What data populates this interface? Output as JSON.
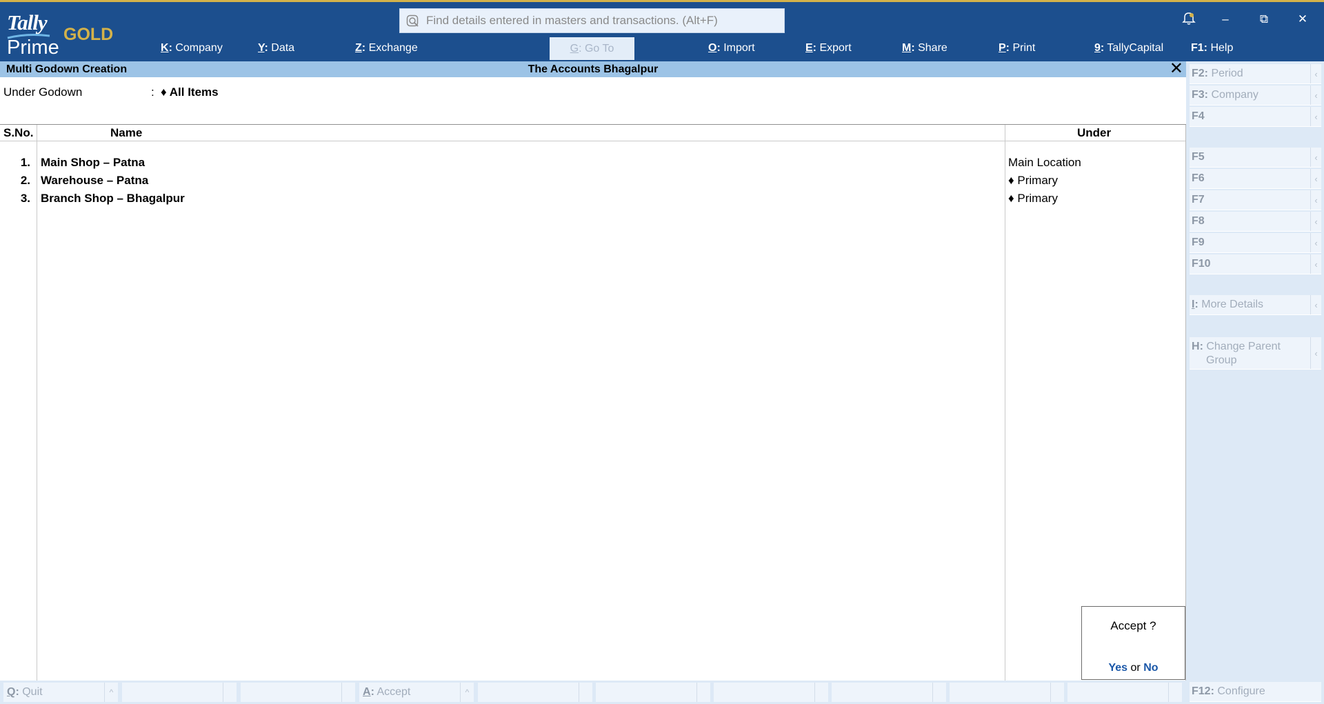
{
  "app": {
    "logo_tally": "Tally",
    "logo_prime": "Prime",
    "logo_edition": "GOLD"
  },
  "search": {
    "placeholder": "Find details entered in masters and transactions. (Alt+F)"
  },
  "top_menu": [
    {
      "key": "K",
      "label": "Company"
    },
    {
      "key": "Y",
      "label": "Data"
    },
    {
      "key": "Z",
      "label": "Exchange"
    },
    {
      "key": "G",
      "label": "Go To"
    },
    {
      "key": "O",
      "label": "Import"
    },
    {
      "key": "E",
      "label": "Export"
    },
    {
      "key": "M",
      "label": "Share"
    },
    {
      "key": "P",
      "label": "Print"
    },
    {
      "key": "9",
      "label": "TallyCapital"
    },
    {
      "key": "F1",
      "label": "Help"
    }
  ],
  "window_buttons": {
    "notification_icon": "bell-icon",
    "minimize": "–",
    "restore": "⧉",
    "close": "✕"
  },
  "screen": {
    "title": "Multi Godown  Creation",
    "company": "The Accounts Bhagalpur",
    "close": "✕"
  },
  "form": {
    "under_label": "Under Godown",
    "under_colon": ":",
    "under_value": "♦ All Items"
  },
  "table": {
    "headers": {
      "sno": "S.No.",
      "name": "Name",
      "under": "Under"
    },
    "rows": [
      {
        "sno": "1.",
        "name": "Main Shop – Patna",
        "under": "Main Location"
      },
      {
        "sno": "2.",
        "name": "Warehouse – Patna",
        "under": "♦ Primary"
      },
      {
        "sno": "3.",
        "name": "Branch Shop – Bhagalpur",
        "under": "♦ Primary"
      }
    ]
  },
  "side_buttons": {
    "f2": {
      "key": "F2",
      "label": "Period"
    },
    "f3": {
      "key": "F3",
      "label": "Company"
    },
    "f4": {
      "key": "F4",
      "label": ""
    },
    "f5": {
      "key": "F5",
      "label": ""
    },
    "f6": {
      "key": "F6",
      "label": ""
    },
    "f7": {
      "key": "F7",
      "label": ""
    },
    "f8": {
      "key": "F8",
      "label": ""
    },
    "f9": {
      "key": "F9",
      "label": ""
    },
    "f10": {
      "key": "F10",
      "label": ""
    },
    "i": {
      "key": "I",
      "label": "More Details"
    },
    "h": {
      "key": "H",
      "label": "Change Parent",
      "label2": "Group"
    },
    "f12": {
      "key": "F12",
      "label": "Configure"
    },
    "arrow": "‹"
  },
  "dialog": {
    "question": "Accept ?",
    "yes": "Yes",
    "or": "or",
    "no": "No"
  },
  "footer": {
    "quit": {
      "key": "Q",
      "label": "Quit"
    },
    "accept": {
      "key": "A",
      "label": "Accept"
    },
    "arrow": "^"
  },
  "colors": {
    "header_bg": "#1c4f8e",
    "title_bar_bg": "#9cc3e6",
    "gold": "#d4b24a",
    "sidebar_bg": "#dde9f6",
    "link_blue": "#1a57a8"
  }
}
